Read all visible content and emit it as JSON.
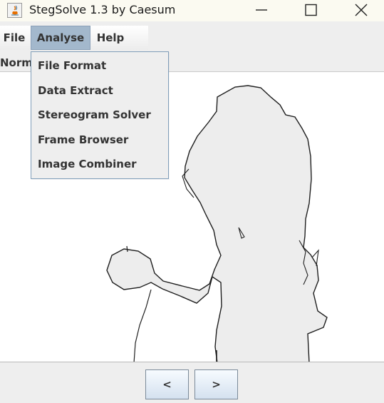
{
  "window": {
    "title": "StegSolve 1.3 by Caesum",
    "app_icon": "java-coffee-cup-icon",
    "controls": {
      "minimize_icon": "minimize-icon",
      "maximize_icon": "maximize-icon",
      "close_icon": "close-icon"
    }
  },
  "menubar": {
    "items": [
      {
        "label": "File"
      },
      {
        "label": "Analyse",
        "active": true
      },
      {
        "label": "Help"
      }
    ],
    "active_color": "#a3b8cc"
  },
  "toolbar": {
    "mode_label": "Norm"
  },
  "analyse_menu": {
    "items": [
      {
        "label": "File Format"
      },
      {
        "label": "Data Extract"
      },
      {
        "label": "Stereogram Solver"
      },
      {
        "label": "Frame Browser"
      },
      {
        "label": "Image Combiner"
      }
    ]
  },
  "navigation": {
    "prev_label": "<",
    "next_label": ">"
  }
}
